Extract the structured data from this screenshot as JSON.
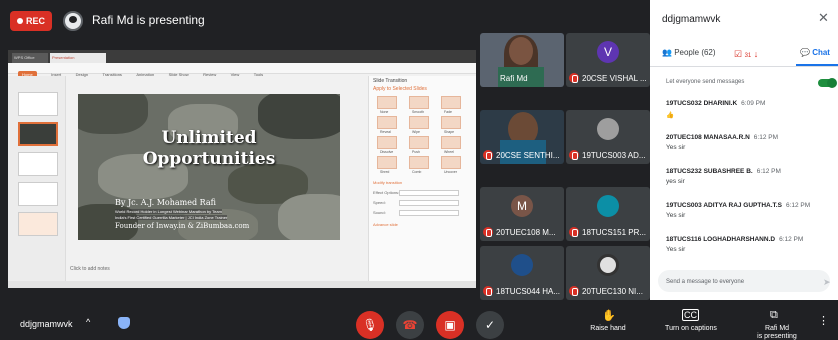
{
  "header": {
    "rec_label": "REC",
    "presenting_text": "Rafi Md is presenting"
  },
  "presentation": {
    "app_tabs": [
      "WPS Office",
      "Presentation"
    ],
    "ribbon_tabs": [
      "Home",
      "Insert",
      "Design",
      "Transitions",
      "Animation",
      "Slide Show",
      "Review",
      "View",
      "Tools"
    ],
    "slide": {
      "title_line1": "Unlimited",
      "title_line2": "Opportunities",
      "author": "By Jc. A.J. Mohamed Rafi",
      "line1": "World Record Holder in Longest Webinar Marathon by Team",
      "line2": "India's First Certified Guerrilla Marketer | JCI India Zone Trainer",
      "founder": "Founder of Inway.in & ZiBumbaa.com"
    },
    "notes_placeholder": "Click to add notes",
    "pane": {
      "title": "Slide Transition",
      "apply_label": "Apply to Selected Slides",
      "effects": [
        "None",
        "Smooth",
        "Fade",
        "Reveal",
        "Wipe",
        "Shape",
        "Dissolve",
        "Push",
        "Wheel",
        "Shred",
        "Comb",
        "Uncover"
      ],
      "modify_label": "Modify transition",
      "effect_options_label": "Effect Options:",
      "speed_label": "Speed:",
      "sound_label": "Sound:",
      "advance_label": "Advance slide"
    }
  },
  "participants": [
    {
      "name": "Rafi Md",
      "type": "video",
      "muted": false
    },
    {
      "name": "20CSE VISHAL ...",
      "initial": "V",
      "color": "#5e35b1"
    },
    {
      "name": "20CSE SENTHI...",
      "type": "video"
    },
    {
      "name": "19TUCS003 AD...",
      "type": "photo"
    },
    {
      "name": "20TUEC108 M...",
      "initial": "M",
      "color": "#795548"
    },
    {
      "name": "18TUCS151 PR...",
      "type": "photo"
    },
    {
      "name": "18TUCS044 HA...",
      "type": "photo"
    },
    {
      "name": "20TUEC130 NI...",
      "type": "photo"
    }
  ],
  "chat_panel": {
    "meeting_code": "ddjgmamwvk",
    "people_label": "People (62)",
    "activities_count": "31",
    "chat_label": "Chat",
    "allow_label": "Let everyone send messages",
    "messages": [
      {
        "sender": "19TUCS032 DHARINI.K",
        "time": "6:09 PM",
        "text": "👍"
      },
      {
        "sender": "20TUEC108 MANASAA.R.N",
        "time": "6:12 PM",
        "text": "Yes sir"
      },
      {
        "sender": "18TUCS232 SUBASHREE B.",
        "time": "6:12 PM",
        "text": "yes sir"
      },
      {
        "sender": "19TUCS003 ADITYA RAJ GUPTHA.T.S",
        "time": "6:12 PM",
        "text": "Yes sir"
      },
      {
        "sender": "18TUCS116 LOGHADHARSHANN.D",
        "time": "6:12 PM",
        "text": "Yes sir"
      }
    ],
    "send_placeholder": "Send a message to everyone"
  },
  "bottom_bar": {
    "meeting_code": "ddjgmamwvk",
    "raise_hand": "Raise hand",
    "captions": "Turn on captions",
    "presenter": "Rafi Md",
    "presenter_sub": "is presenting"
  }
}
